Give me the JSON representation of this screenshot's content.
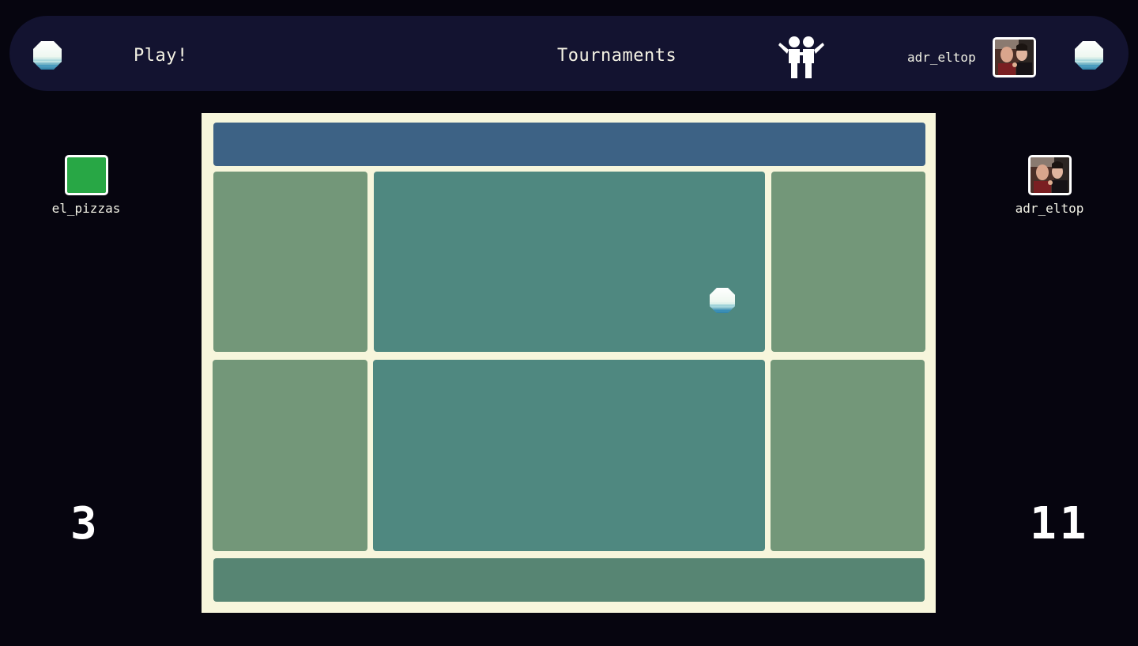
{
  "nav": {
    "play_label": "Play!",
    "tournaments_label": "Tournaments",
    "username": "adr_eltop",
    "icons": {
      "left_logo": "pong-ball-icon",
      "right_logo": "pong-ball-icon",
      "friends": "friends-icon"
    }
  },
  "match": {
    "left_player": {
      "name": "el_pizzas",
      "score": "3",
      "avatar_color": "#28a745"
    },
    "right_player": {
      "name": "adr_eltop",
      "score": "11"
    }
  },
  "colors": {
    "background": "#06050f",
    "navbar": "#131330",
    "court_lines": "#f7f6dc",
    "top_band": "#3d6285",
    "bottom_band": "#578573",
    "side_zone": "#739779",
    "center_zone": "#4f8880"
  }
}
